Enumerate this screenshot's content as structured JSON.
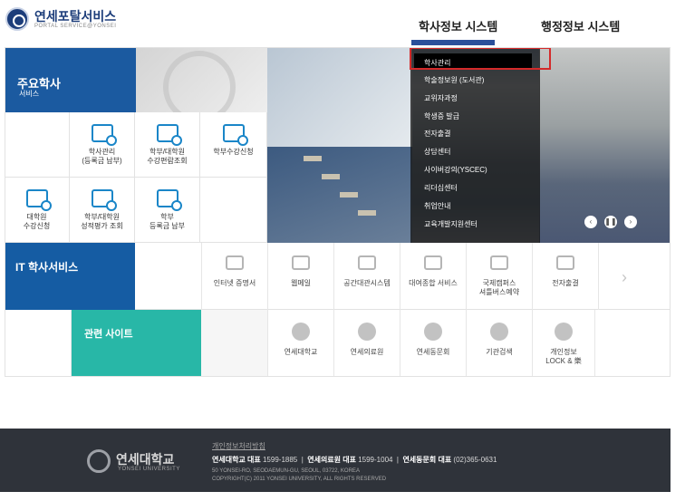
{
  "header": {
    "logo_title": "연세포탈서비스",
    "logo_sub": "PORTAL SERVICE@YONSEI",
    "nav": [
      "학사정보 시스템",
      "행정정보 시스템"
    ]
  },
  "main_banner": {
    "title": "주요학사",
    "sub": "서비스"
  },
  "main_services": [
    "학사관리\n(등록금 납부)",
    "학부/대학원\n수강편람조회",
    "학부수강신청",
    "대학원\n수강신청",
    "학부/대학원\n성적평가 조회",
    "학부\n등록금 납부"
  ],
  "dropdown": [
    "학사관리",
    "학술정보원 (도서관)",
    "교위자과정",
    "학생증 발급",
    "전자출결",
    "상담센터",
    "사이버강의(YSCEC)",
    "리더십센터",
    "취업안내",
    "교육개발지원센터"
  ],
  "it_service": {
    "title": "IT 학사서비스",
    "items": [
      "인터넷 증명서",
      "웹메일",
      "공간대관시스템",
      "대여종합 서비스",
      "국제캠퍼스\n셔틀버스예약",
      "전자출결"
    ]
  },
  "related": {
    "title": "관련 사이트",
    "items": [
      "연세대학교",
      "연세의료원",
      "연세동문회",
      "기관검색",
      "개인정보\nLOCK & 樂"
    ]
  },
  "slide_controls": [
    "‹",
    "❚❚",
    "›"
  ],
  "footer": {
    "name": "연세대학교",
    "name_sub": "YONSEI UNIVERSITY",
    "privacy": "개인정보처리방침",
    "phone1_label": "연세대학교 대표",
    "phone1": "1599-1885",
    "phone2_label": "연세의료원 대표",
    "phone2": "1599-1004",
    "phone3_label": "연세동문회 대표",
    "phone3": "(02)365-0631",
    "address": "50 YONSEI-RO, SEODAEMUN-GU, SEOUL, 03722, KOREA",
    "copyright": "COPYRIGHT(C) 2011 YONSEI UNIVERSITY, ALL RIGHTS RESERVED"
  },
  "colors": {
    "brand_blue": "#1b5aa0",
    "it_blue": "#155ca3",
    "related_teal": "#28b7a7",
    "highlight_red": "#d42a2a",
    "footer_bg": "#2f333a"
  }
}
